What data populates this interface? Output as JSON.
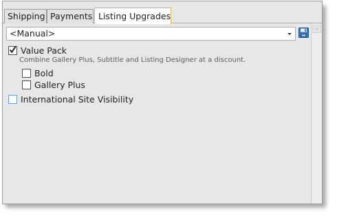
{
  "tabs": [
    {
      "label": "Shipping",
      "active": false
    },
    {
      "label": "Payments",
      "active": false
    },
    {
      "label": "Listing Upgrades",
      "active": true
    }
  ],
  "template_select": {
    "value": "<Manual>"
  },
  "upgrades": {
    "value_pack": {
      "label": "Value Pack",
      "checked": true,
      "description": "Combine Gallery Plus, Subtitle and Listing Designer at a discount."
    },
    "bold": {
      "label": "Bold",
      "checked": false
    },
    "gallery_plus": {
      "label": "Gallery Plus",
      "checked": false
    },
    "international_site_visibility": {
      "label": "International Site Visibility",
      "checked": false
    }
  },
  "colors": {
    "active_tab_border": "#d6b94e",
    "panel_background": "#e7e7e7",
    "focus_checkbox_border": "#6b9ad4"
  }
}
